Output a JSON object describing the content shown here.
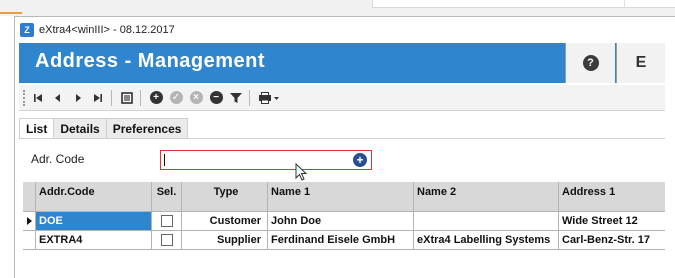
{
  "window": {
    "title": "eXtra4<winIII> - 08.12.2017",
    "app_icon": "Z"
  },
  "header": {
    "title": "Address - Management",
    "help_glyph": "?",
    "exit_glyph": "E"
  },
  "toolbar": {
    "buttons": [
      "first-record-icon",
      "previous-record-icon",
      "next-record-icon",
      "last-record-icon",
      "grid-view-icon",
      "add-icon",
      "confirm-icon",
      "cancel-icon",
      "remove-icon",
      "filter-icon",
      "print-icon"
    ]
  },
  "tabs": [
    {
      "label": "List",
      "active": true
    },
    {
      "label": "Details",
      "active": false
    },
    {
      "label": "Preferences",
      "active": false
    }
  ],
  "filter": {
    "label": "Adr. Code",
    "value": ""
  },
  "grid": {
    "columns": [
      "Addr.Code",
      "Sel.",
      "Type",
      "Name 1",
      "Name 2",
      "Address 1"
    ],
    "rows": [
      {
        "code": "DOE",
        "selected": false,
        "type": "Customer",
        "name1": "John Doe",
        "name2": "",
        "address1": "Wide Street 12",
        "current": true
      },
      {
        "code": "EXTRA4",
        "selected": false,
        "type": "Supplier",
        "name1": "Ferdinand Eisele GmbH",
        "name2": "eXtra4 Labelling Systems",
        "address1": "Carl-Benz-Str. 17",
        "current": false
      }
    ]
  },
  "colors": {
    "header_blue": "#2f86ce",
    "accent_orange": "#f19a3e",
    "input_border_red": "#d9363e"
  }
}
